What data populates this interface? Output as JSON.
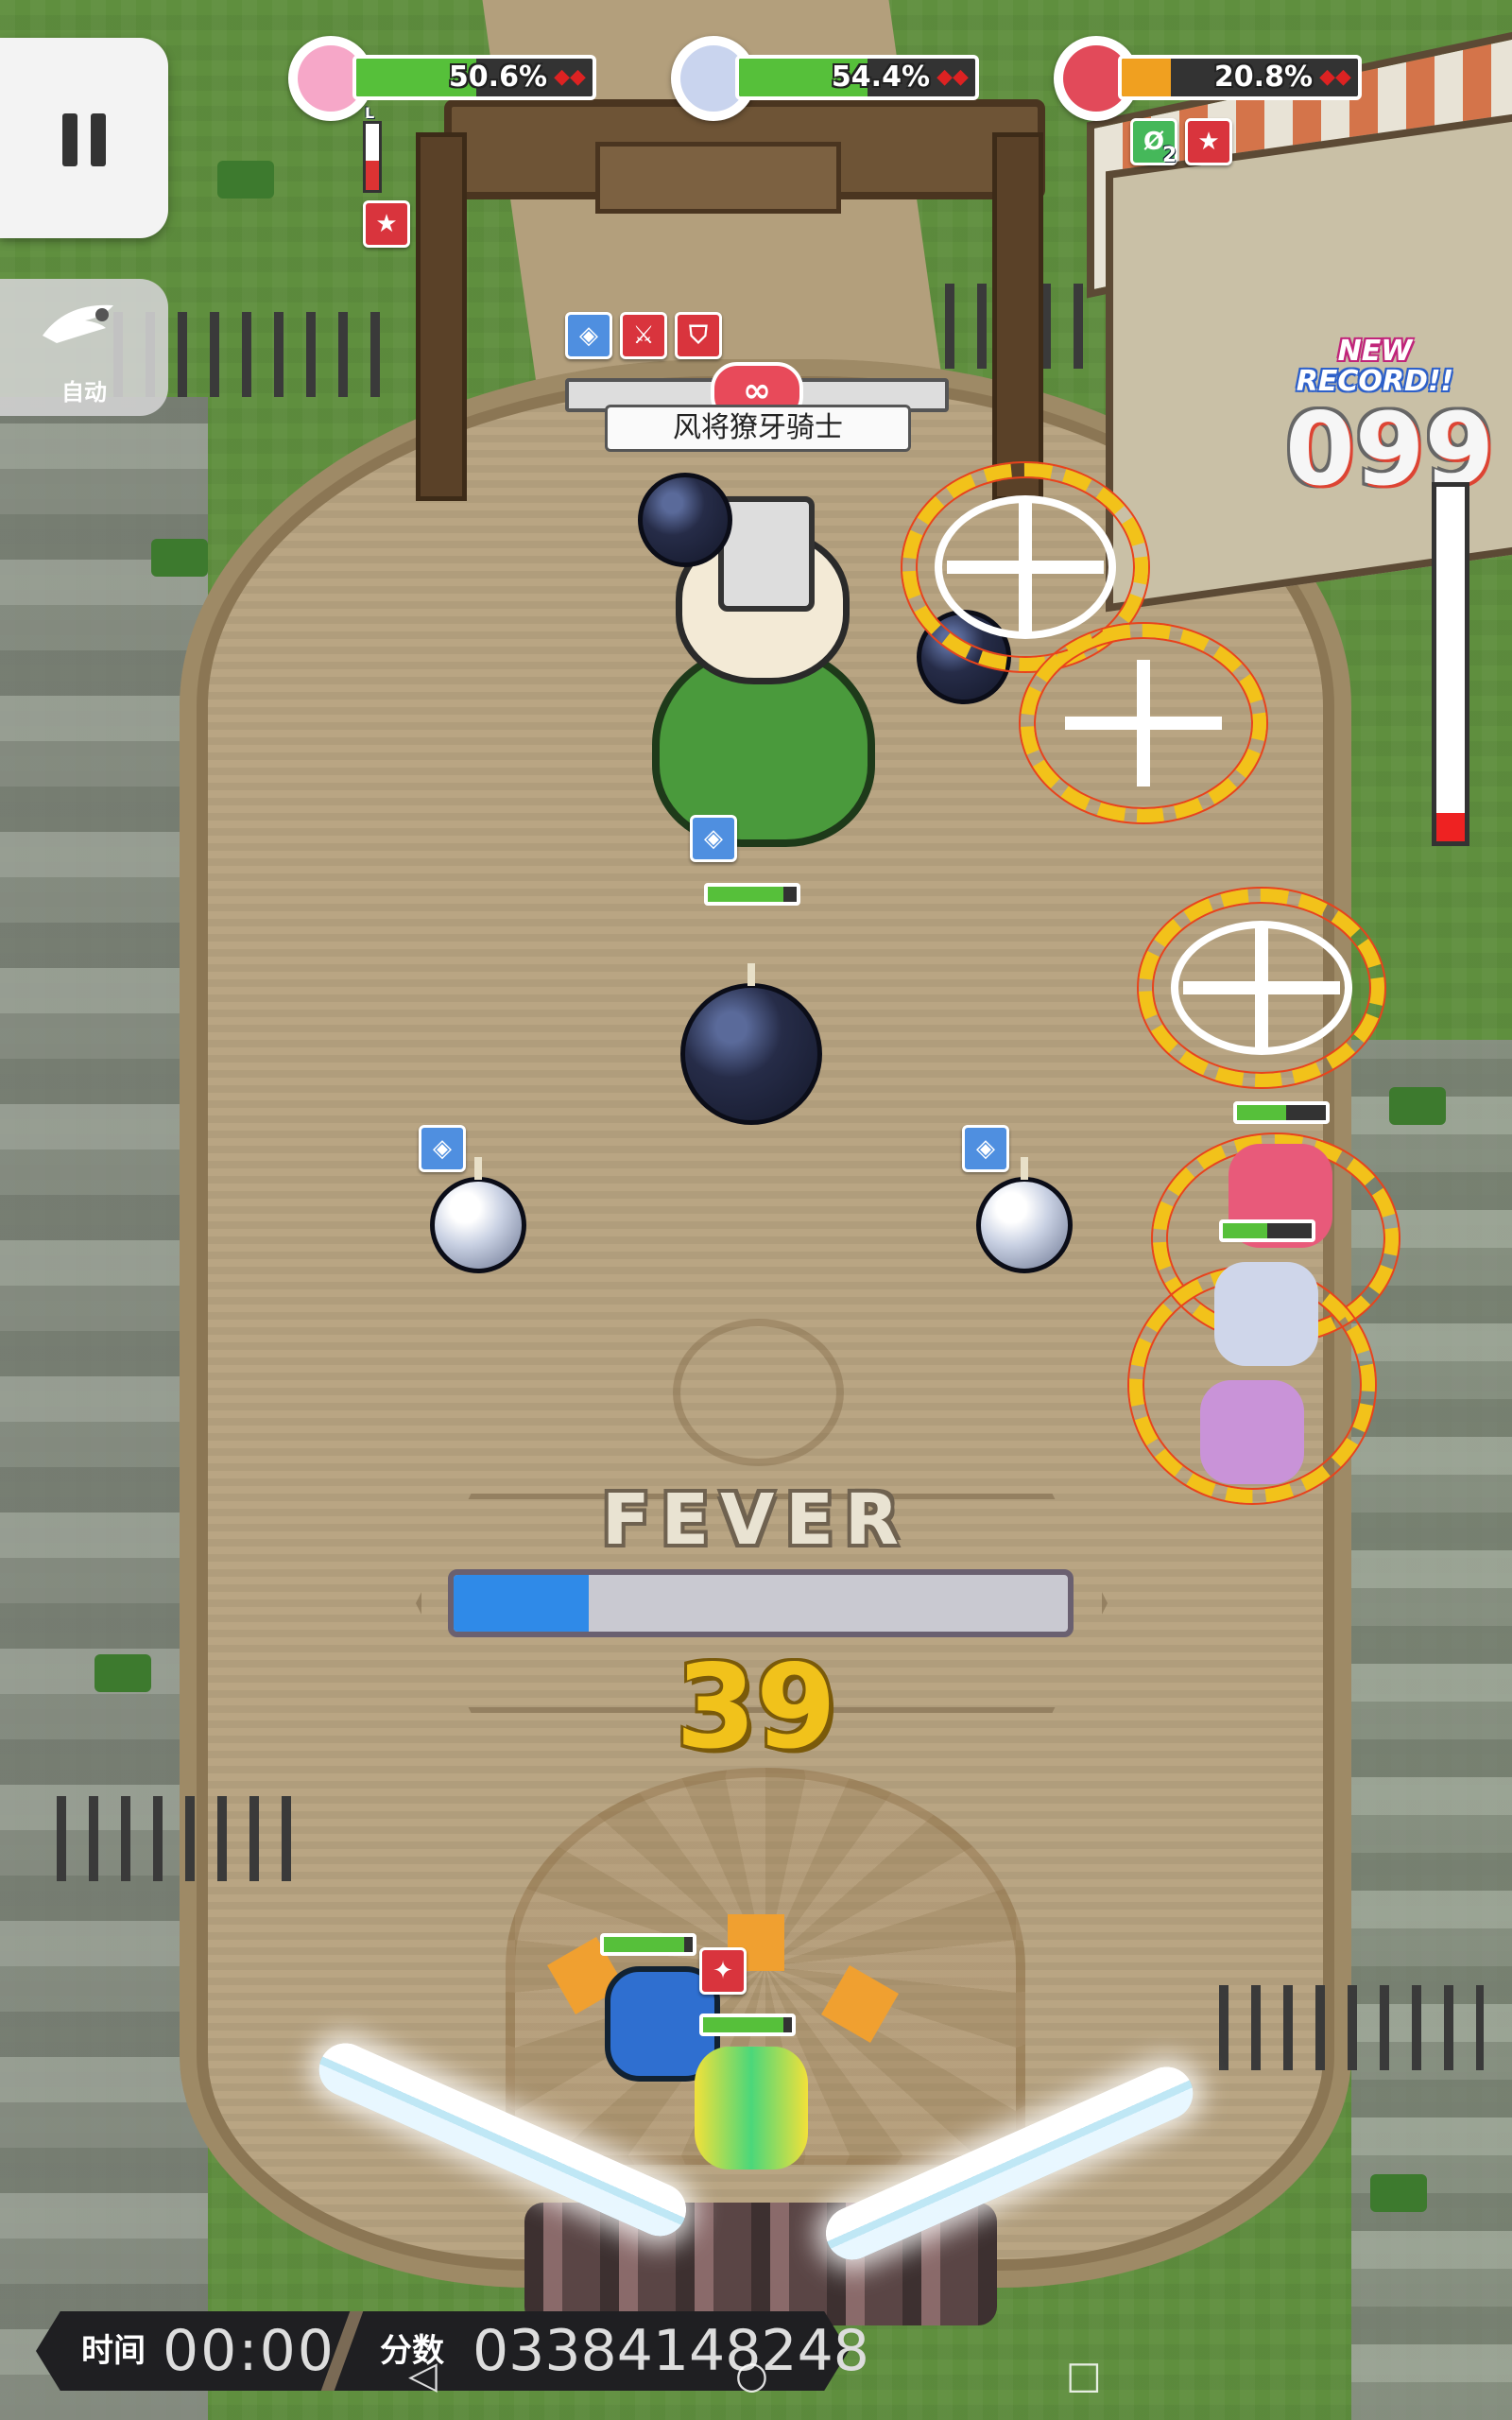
{
  "hud": {
    "pause_icon": "pause-icon",
    "auto_label": "自动",
    "auto_icon": "wing-icon"
  },
  "party": [
    {
      "name_icon": "pink-hair-portrait",
      "hp_percent": 50.6,
      "hp_text": "50.6%",
      "bar_color": "#56c03a"
    },
    {
      "name_icon": "silver-hair-portrait",
      "hp_percent": 54.4,
      "hp_text": "54.4%",
      "bar_color": "#56c03a"
    },
    {
      "name_icon": "red-hair-portrait",
      "hp_percent": 20.8,
      "hp_text": "20.8%",
      "bar_color": "#f0a020"
    }
  ],
  "party_status": {
    "p1_gauge_label": "L",
    "p3_buff_count": "2"
  },
  "boss": {
    "name": "风将獠牙骑士",
    "hp_symbol": "∞"
  },
  "record": {
    "line1": "NEW",
    "line2": "RECORD!!",
    "combo": "099"
  },
  "fever": {
    "label": "FEVER",
    "fill_fraction": 0.22,
    "count": "39"
  },
  "footer": {
    "time_label": "时间",
    "time_value": "00:00",
    "score_label": "分数",
    "score_value": "03384148248"
  },
  "colors": {
    "accent_blue": "#2f8ae8",
    "fever_gold": "#f1c21b",
    "danger_red": "#e8431c"
  }
}
